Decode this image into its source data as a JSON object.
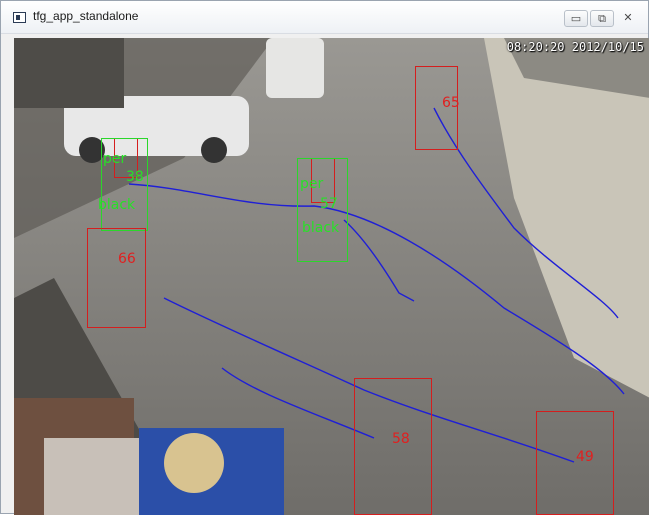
{
  "window": {
    "title": "tfg_app_standalone",
    "minimize_icon": "minimize-icon",
    "maximize_icon": "maximize-icon",
    "close_icon": "close-icon",
    "minimize_glyph": "▭",
    "maximize_glyph": "⧉",
    "close_glyph": "✕"
  },
  "video": {
    "timestamp": "08:20:20 2012/10/15",
    "track_color": "#1f1fd6",
    "detection_color": "#d41e1e",
    "attribute_color": "#2bd62b",
    "detections": [
      {
        "id": "65"
      },
      {
        "id": "38",
        "attributes": [
          "per",
          "black"
        ]
      },
      {
        "id": "57",
        "attributes": [
          "per",
          "black"
        ]
      },
      {
        "id": "66"
      },
      {
        "id": "58"
      },
      {
        "id": "49"
      }
    ]
  }
}
